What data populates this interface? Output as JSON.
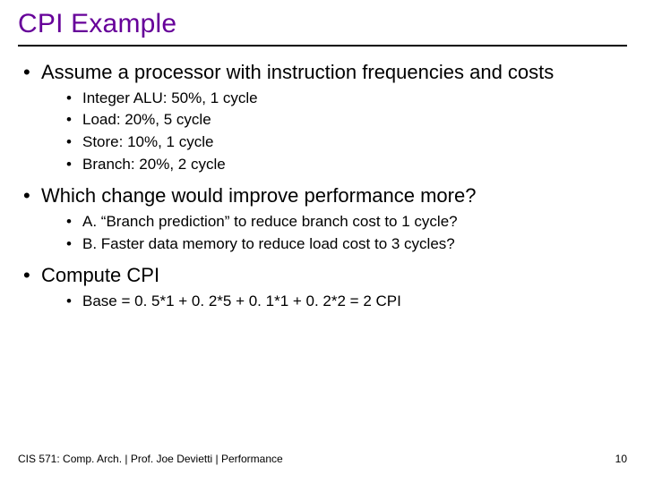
{
  "title": "CPI Example",
  "bullets": [
    {
      "text": "Assume a processor with instruction frequencies and costs",
      "sub": [
        "Integer ALU: 50%, 1 cycle",
        "Load: 20%, 5 cycle",
        "Store: 10%, 1 cycle",
        "Branch: 20%, 2 cycle"
      ]
    },
    {
      "text": "Which change would improve performance more?",
      "sub": [
        "A. “Branch prediction” to reduce branch cost to 1 cycle?",
        "B. Faster data memory to reduce load cost to 3 cycles?"
      ]
    },
    {
      "text": "Compute CPI",
      "sub": [
        "Base = 0. 5*1 + 0. 2*5 + 0. 1*1 + 0. 2*2 = 2 CPI"
      ]
    }
  ],
  "footer": {
    "left": "CIS 571: Comp. Arch.  |  Prof. Joe Devietti  |  Performance",
    "right": "10"
  }
}
